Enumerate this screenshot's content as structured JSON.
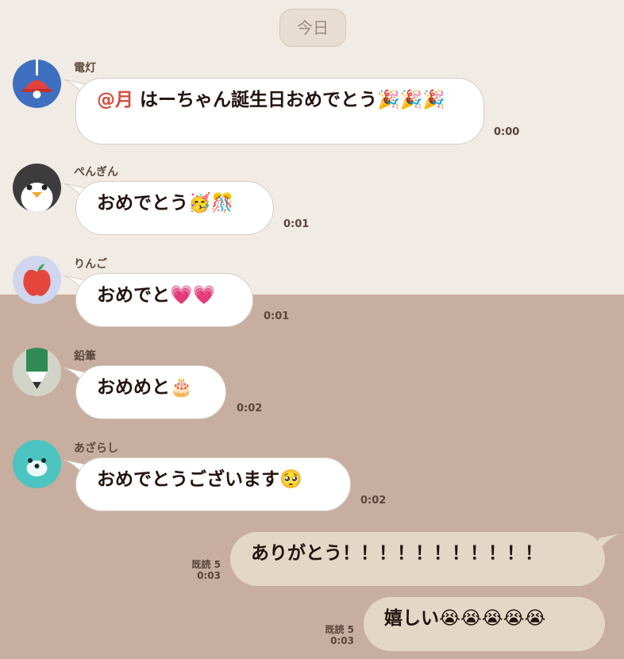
{
  "date_label": "今日",
  "messages": [
    {
      "sender": "電灯",
      "mention": "@月",
      "text": "はーちゃん誕生日おめでとう🎉🎉🎉",
      "time": "0:00"
    },
    {
      "sender": "ぺんぎん",
      "text": "おめでとう🥳🎊",
      "time": "0:01"
    },
    {
      "sender": "りんご",
      "text": "おめでと💗💗",
      "time": "0:01"
    },
    {
      "sender": "鉛筆",
      "text": "おめめと🎂",
      "time": "0:02"
    },
    {
      "sender": "あざらし",
      "text": "おめでとうございます🥺",
      "time": "0:02"
    }
  ],
  "my_messages": [
    {
      "text": "ありがとう！！！！！！！！！！！",
      "read": "既読 5",
      "time": "0:03"
    },
    {
      "text": "嬉しい😭😭😭😭😭",
      "read": "既読 5",
      "time": "0:03"
    }
  ],
  "avatars": {
    "lamp": "lamp-icon",
    "penguin": "penguin-icon",
    "apple": "apple-icon",
    "pencil": "pencil-icon",
    "seal": "seal-icon"
  },
  "colors": {
    "background_top": "#f1ebe5",
    "background_bottom": "#c8aea1",
    "my_bubble": "#e5d7c6",
    "mention": "#d84d3f"
  }
}
